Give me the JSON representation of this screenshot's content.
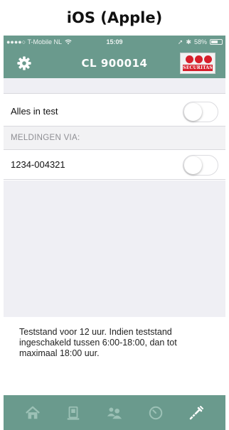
{
  "caption": "iOS (Apple)",
  "status_bar": {
    "carrier": "●●●●○ T-Mobile NL",
    "time": "15:09",
    "battery": "58%"
  },
  "nav": {
    "title": "CL 900014",
    "logo_text": "SECURITAS"
  },
  "settings": {
    "test_label": "Alles in test",
    "test_enabled": false,
    "section_header": "MELDINGEN VIA:",
    "phone_number": "1234-004321",
    "phone_enabled": false
  },
  "footnote": "Teststand voor 12 uur. Indien teststand ingeschakeld tussen 6:00-18:00, dan tot maximaal 18:00 uur.",
  "tabs": [
    {
      "icon": "home-icon"
    },
    {
      "icon": "alarm-panel-icon"
    },
    {
      "icon": "users-icon"
    },
    {
      "icon": "clock-icon"
    },
    {
      "icon": "test-tool-icon",
      "active": true
    }
  ],
  "colors": {
    "brand": "#6a9a8d",
    "logo_red": "#d61e2a"
  }
}
